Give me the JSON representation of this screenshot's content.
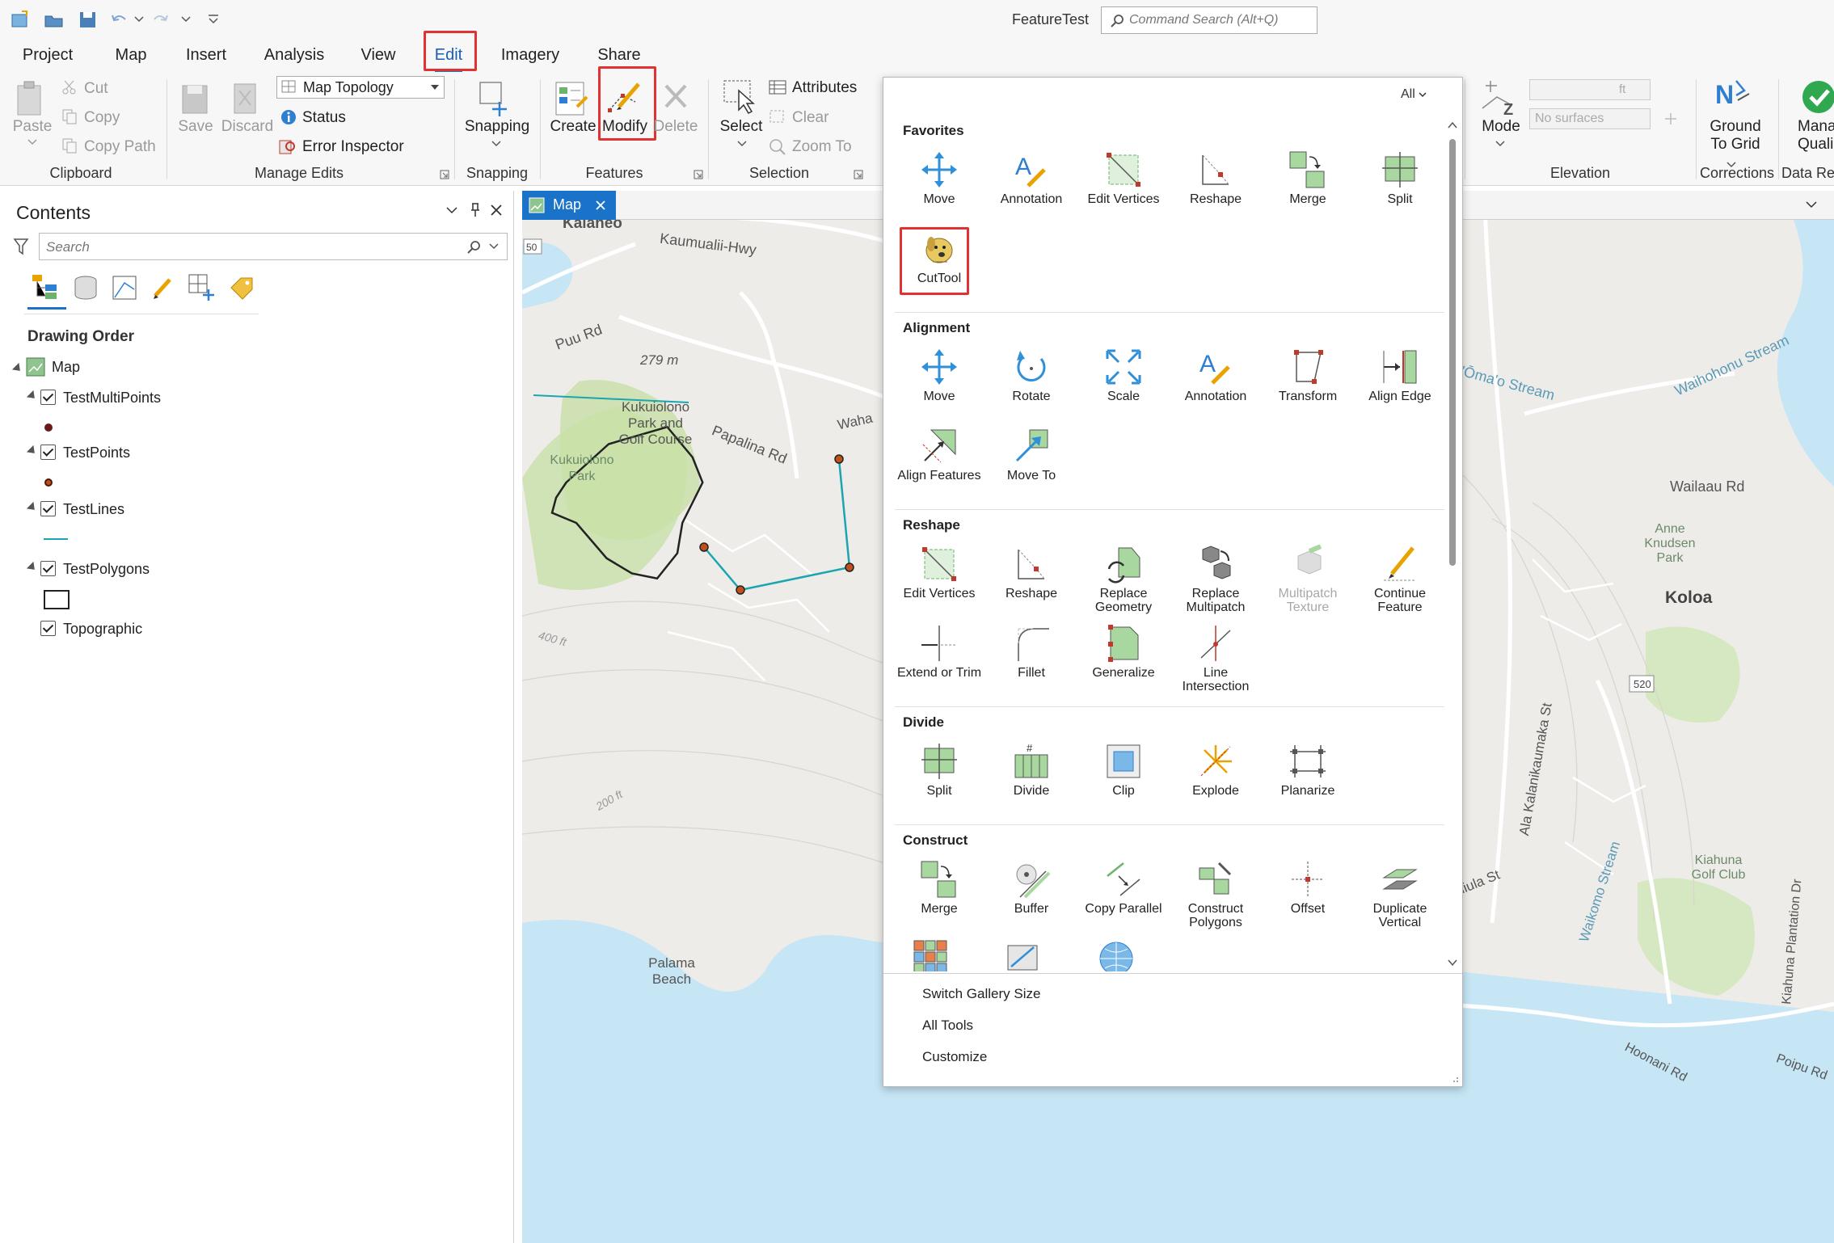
{
  "app": {
    "title": "FeatureTest",
    "search_placeholder": "Command Search (Alt+Q)"
  },
  "ribbon_tabs": [
    "Project",
    "Map",
    "Insert",
    "Analysis",
    "View",
    "Edit",
    "Imagery",
    "Share"
  ],
  "active_tab": "Edit",
  "ribbon": {
    "clipboard": {
      "paste": "Paste",
      "cut": "Cut",
      "copy": "Copy",
      "copy_path": "Copy Path",
      "label": "Clipboard"
    },
    "manage_edits": {
      "save": "Save",
      "discard": "Discard",
      "topology_value": "Map Topology",
      "status": "Status",
      "error_inspector": "Error Inspector",
      "label": "Manage Edits"
    },
    "snapping": {
      "button": "Snapping",
      "label": "Snapping"
    },
    "features": {
      "create": "Create",
      "modify": "Modify",
      "delete": "Delete",
      "label": "Features"
    },
    "selection": {
      "select": "Select",
      "attributes": "Attributes",
      "clear": "Clear",
      "zoom_to": "Zoom To",
      "label": "Selection"
    },
    "elevation": {
      "mode": "Mode",
      "ft": "ft",
      "surface_placeholder": "No surfaces",
      "label": "Elevation"
    },
    "corrections": {
      "ground_to_grid_1": "Ground",
      "ground_to_grid_2": "To Grid",
      "label": "Corrections"
    },
    "data_review": {
      "manage_1": "Mana",
      "manage_2": "Quali",
      "label": "Data Rev"
    }
  },
  "contents": {
    "title": "Contents",
    "search_placeholder": "Search",
    "drawing_order": "Drawing Order",
    "layers": [
      {
        "name": "Map"
      },
      {
        "name": "TestMultiPoints"
      },
      {
        "name": "TestPoints"
      },
      {
        "name": "TestLines"
      },
      {
        "name": "TestPolygons"
      },
      {
        "name": "Topographic"
      }
    ]
  },
  "map_tab": {
    "label": "Map"
  },
  "map_labels": {
    "kalaheo": "Kalaheo",
    "kaumualii": "Kaumualii-Hwy",
    "puu_rd": "Puu Rd",
    "elev_279": "279 m",
    "kukuiolono_1": "Kukuiolono",
    "kukuiolono_2": "Park and",
    "kukuiolono_3": "Golf Course",
    "kukuiolono_park_1": "Kukuiolono",
    "kukuiolono_park_2": "Park",
    "papalina": "Papalina Rd",
    "waha": "Waha",
    "ft400": "400 ft",
    "ft200": "200 ft",
    "palama_1": "Palama",
    "palama_2": "Beach",
    "shield50": "50",
    "omao": "'Ōma'o Stream",
    "waihohonu": "Waihohonu Stream",
    "wailaau": "Wailaau Rd",
    "anne_1": "Anne",
    "anne_2": "Knudsen",
    "anne_3": "Park",
    "koloa": "Koloa",
    "shield520": "520",
    "alakalanikaumaka": "Ala Kalanikaumaka St",
    "kukuiula": "Kukuiula St",
    "waikomo": "Waikomo Stream",
    "kiahuna_1": "Kiahuna",
    "kiahuna_2": "Golf Club",
    "kiahuna_plantation": "Kiahuna Plantation Dr",
    "hoonani": "Hoonani Rd",
    "poipu": "Poipu Rd"
  },
  "gallery": {
    "filter": "All",
    "sections": [
      {
        "title": "Favorites",
        "tools": [
          "Move",
          "Annotation",
          "Edit Vertices",
          "Reshape",
          "Merge",
          "Split",
          "CutTool"
        ]
      },
      {
        "title": "Alignment",
        "tools": [
          "Move",
          "Rotate",
          "Scale",
          "Annotation",
          "Transform",
          "Align Edge",
          "Align Features",
          "Move To"
        ]
      },
      {
        "title": "Reshape",
        "tools": [
          "Edit Vertices",
          "Reshape",
          "Replace Geometry",
          "Replace Multipatch",
          "Multipatch Texture",
          "Continue Feature",
          "Extend or Trim",
          "Fillet",
          "Generalize",
          "Line Intersection"
        ]
      },
      {
        "title": "Divide",
        "tools": [
          "Split",
          "Divide",
          "Clip",
          "Explode",
          "Planarize"
        ]
      },
      {
        "title": "Construct",
        "tools": [
          "Merge",
          "Buffer",
          "Copy Parallel",
          "Construct Polygons",
          "Offset",
          "Duplicate Vertical"
        ]
      }
    ],
    "menu": [
      "Switch Gallery Size",
      "All Tools",
      "Customize"
    ]
  },
  "colors": {
    "accent": "#1a73c8",
    "highlight": "#e03232",
    "polygon_fill": "#c8e0a8",
    "line": "#1aa5b0",
    "water": "#c6e6f6"
  }
}
